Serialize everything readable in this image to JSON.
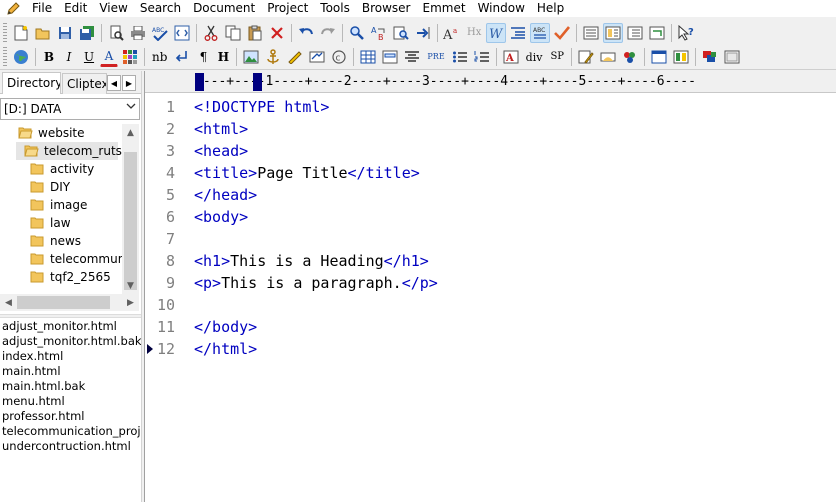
{
  "menubar": {
    "items": [
      "File",
      "Edit",
      "View",
      "Search",
      "Document",
      "Project",
      "Tools",
      "Browser",
      "Emmet",
      "Window",
      "Help"
    ]
  },
  "toolbar2": {
    "bold": "B",
    "italic": "I",
    "underline": "U",
    "font_color": "A",
    "nbsp": "nb",
    "paragraph": "¶",
    "heading": "H",
    "div": "div",
    "span": "SP",
    "pre": "PRE",
    "hx": "Hx"
  },
  "leftpane": {
    "tabs": [
      "Directory",
      "Cliptex"
    ],
    "drive": "[D:] DATA",
    "tree": [
      {
        "label": "website",
        "level": 1,
        "open": true
      },
      {
        "label": "telecom_ruts",
        "level": 2,
        "open": true,
        "selected": true
      },
      {
        "label": "activity",
        "level": 3
      },
      {
        "label": "DIY",
        "level": 3
      },
      {
        "label": "image",
        "level": 3
      },
      {
        "label": "law",
        "level": 3
      },
      {
        "label": "news",
        "level": 3
      },
      {
        "label": "telecommuni",
        "level": 3
      },
      {
        "label": "tqf2_2565",
        "level": 3
      }
    ],
    "files": [
      "adjust_monitor.html",
      "adjust_monitor.html.bak",
      "index.html",
      "main.html",
      "main.html.bak",
      "menu.html",
      "professor.html",
      "telecommunication_proje",
      "undercontruction.html"
    ]
  },
  "editor": {
    "ruler": "----+----1----+----2----+----3----+----4----+----5----+----6----",
    "current_line": 12,
    "lines": [
      {
        "n": "1",
        "parts": [
          {
            "t": "<!DOCTYPE html>",
            "c": "tag"
          }
        ]
      },
      {
        "n": "2",
        "parts": [
          {
            "t": "<html>",
            "c": "tag"
          }
        ]
      },
      {
        "n": "3",
        "parts": [
          {
            "t": "<head>",
            "c": "tag"
          }
        ]
      },
      {
        "n": "4",
        "parts": [
          {
            "t": "<title>",
            "c": "tag"
          },
          {
            "t": "Page Title",
            "c": "txt"
          },
          {
            "t": "</title>",
            "c": "tag"
          }
        ]
      },
      {
        "n": "5",
        "parts": [
          {
            "t": "</head>",
            "c": "tag"
          }
        ]
      },
      {
        "n": "6",
        "parts": [
          {
            "t": "<body>",
            "c": "tag"
          }
        ]
      },
      {
        "n": "7",
        "parts": []
      },
      {
        "n": "8",
        "parts": [
          {
            "t": "<h1>",
            "c": "tag"
          },
          {
            "t": "This is a Heading",
            "c": "txt"
          },
          {
            "t": "</h1>",
            "c": "tag"
          }
        ]
      },
      {
        "n": "9",
        "parts": [
          {
            "t": "<p>",
            "c": "tag"
          },
          {
            "t": "This is a paragraph.",
            "c": "txt"
          },
          {
            "t": "</p>",
            "c": "tag"
          }
        ]
      },
      {
        "n": "10",
        "parts": []
      },
      {
        "n": "11",
        "parts": [
          {
            "t": "</body>",
            "c": "tag"
          }
        ]
      },
      {
        "n": "12",
        "parts": [
          {
            "t": "</html>",
            "c": "tag"
          }
        ]
      }
    ]
  },
  "colors": {
    "tag": "#0000c0",
    "line_number": "#7f7f7f",
    "folder": "#f2c55c",
    "ruler_marker": "#000080"
  }
}
